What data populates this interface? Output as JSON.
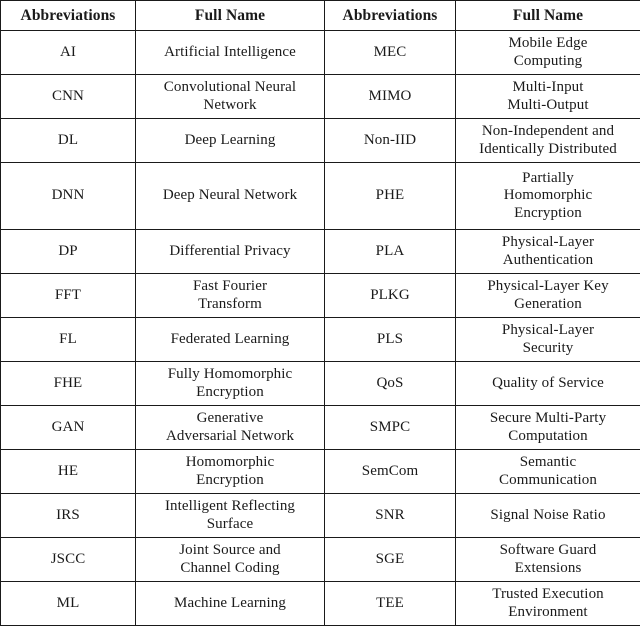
{
  "table": {
    "headers": [
      "Abbreviations",
      "Full Name",
      "Abbreviations",
      "Full Name"
    ],
    "rows": [
      {
        "abbr_left": "AI",
        "full_left": "Artificial Intelligence",
        "abbr_right": "MEC",
        "full_right": "Mobile Edge\nComputing",
        "tall": false
      },
      {
        "abbr_left": "CNN",
        "full_left": "Convolutional Neural\nNetwork",
        "abbr_right": "MIMO",
        "full_right": "Multi-Input\nMulti-Output",
        "tall": false
      },
      {
        "abbr_left": "DL",
        "full_left": "Deep Learning",
        "abbr_right": "Non-IID",
        "full_right": "Non-Independent and\nIdentically Distributed",
        "tall": false
      },
      {
        "abbr_left": "DNN",
        "full_left": "Deep Neural Network",
        "abbr_right": "PHE",
        "full_right": "Partially\nHomomorphic\nEncryption",
        "tall": true
      },
      {
        "abbr_left": "DP",
        "full_left": "Differential Privacy",
        "abbr_right": "PLA",
        "full_right": "Physical-Layer\nAuthentication",
        "tall": false
      },
      {
        "abbr_left": "FFT",
        "full_left": "Fast Fourier\nTransform",
        "abbr_right": "PLKG",
        "full_right": "Physical-Layer Key\nGeneration",
        "tall": false
      },
      {
        "abbr_left": "FL",
        "full_left": "Federated Learning",
        "abbr_right": "PLS",
        "full_right": "Physical-Layer\nSecurity",
        "tall": false
      },
      {
        "abbr_left": "FHE",
        "full_left": "Fully Homomorphic\nEncryption",
        "abbr_right": "QoS",
        "full_right": "Quality of Service",
        "tall": false
      },
      {
        "abbr_left": "GAN",
        "full_left": "Generative\nAdversarial Network",
        "abbr_right": "SMPC",
        "full_right": "Secure Multi-Party\nComputation",
        "tall": false
      },
      {
        "abbr_left": "HE",
        "full_left": "Homomorphic\nEncryption",
        "abbr_right": "SemCom",
        "full_right": "Semantic\nCommunication",
        "tall": false
      },
      {
        "abbr_left": "IRS",
        "full_left": "Intelligent Reflecting\nSurface",
        "abbr_right": "SNR",
        "full_right": "Signal Noise Ratio",
        "tall": false
      },
      {
        "abbr_left": "JSCC",
        "full_left": "Joint Source and\nChannel Coding",
        "abbr_right": "SGE",
        "full_right": "Software Guard\nExtensions",
        "tall": false
      },
      {
        "abbr_left": "ML",
        "full_left": "Machine Learning",
        "abbr_right": "TEE",
        "full_right": "Trusted Execution\nEnvironment",
        "tall": false
      }
    ]
  },
  "style": {
    "border_color": "#1a1a1a",
    "text_color": "#1a1a1a",
    "background": "#ffffff"
  }
}
